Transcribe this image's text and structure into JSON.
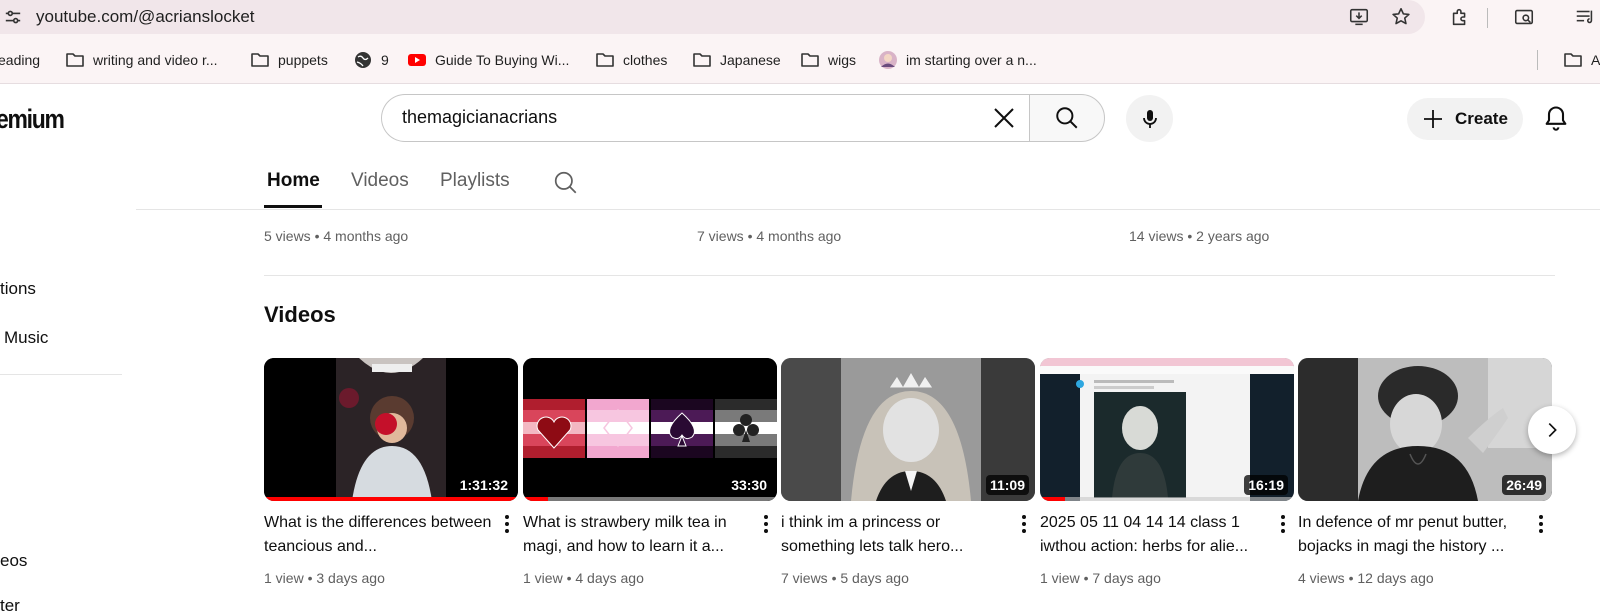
{
  "browser": {
    "url": "youtube.com/@acrianslocket",
    "bookmarks": [
      {
        "label": "eading",
        "icon": "folder-icon"
      },
      {
        "label": "writing and video r...",
        "icon": "folder-icon"
      },
      {
        "label": "puppets",
        "icon": "folder-icon"
      },
      {
        "label": "9",
        "icon": "globe-icon"
      },
      {
        "label": "Guide To Buying Wi...",
        "icon": "youtube-icon"
      },
      {
        "label": "clothes",
        "icon": "folder-icon"
      },
      {
        "label": "Japanese",
        "icon": "folder-icon"
      },
      {
        "label": "wigs",
        "icon": "folder-icon"
      },
      {
        "label": "im starting over a n...",
        "icon": "avatar-icon"
      },
      {
        "label": "A",
        "icon": "folder-icon"
      }
    ]
  },
  "header": {
    "logo_text": "emium",
    "search_value": "themagicianacrians",
    "create_label": "Create"
  },
  "left_nav": {
    "item_1": "tions",
    "item_2": "Music",
    "item_3": "eos",
    "item_4": "ter"
  },
  "tabs": [
    {
      "label": "Home",
      "active": true
    },
    {
      "label": "Videos",
      "active": false
    },
    {
      "label": "Playlists",
      "active": false
    }
  ],
  "previous_shelf": [
    {
      "views": "5 views",
      "age": "4 months ago"
    },
    {
      "views": "7 views",
      "age": "4 months ago"
    },
    {
      "views": "14 views",
      "age": "2 years ago"
    }
  ],
  "videos_section": {
    "title": "Videos",
    "videos": [
      {
        "title": "What is the differences between teancious and...",
        "duration": "1:31:32",
        "views": "1 view",
        "age": "3 days ago",
        "progress": 1.0
      },
      {
        "title": "What is strawbery milk tea in magi, and how to learn it a...",
        "duration": "33:30",
        "views": "1 view",
        "age": "4 days ago",
        "progress": 0.1
      },
      {
        "title": "i think im a princess or something lets talk hero...",
        "duration": "11:09",
        "views": "7 views",
        "age": "5 days ago",
        "progress": 0
      },
      {
        "title": "2025 05 11 04 14 14 class 1 iwthou action: herbs for alie...",
        "duration": "16:19",
        "views": "1 view",
        "age": "7 days ago",
        "progress": 0.1
      },
      {
        "title": "In defence of mr penut butter, bojacks in magi the history ...",
        "duration": "26:49",
        "views": "4 views",
        "age": "12 days ago",
        "progress": 0
      }
    ]
  },
  "colors": {
    "accent": "#ff0000",
    "chrome_bg": "#fbf4f5",
    "omnibox_bg": "#f1e6ea"
  }
}
